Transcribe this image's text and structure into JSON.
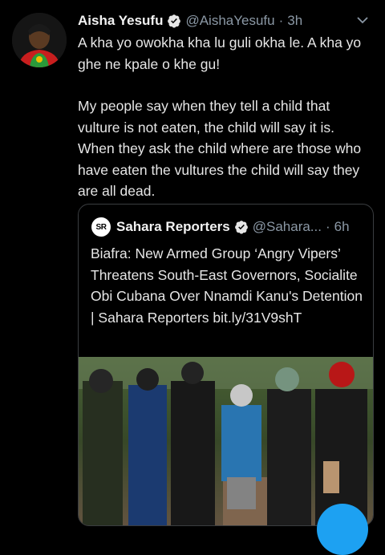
{
  "tweet": {
    "author_name": "Aisha Yesufu",
    "handle": "@AishaYesufu",
    "separator": "·",
    "time": "3h",
    "text_line1": "A kha yo owokha kha lu guli okha le. A kha yo ghe ne kpale o khe gu!",
    "text_line2": "My people say when they tell a child that vulture is not eaten, the child will say it is. When they ask the child where are those who have eaten the vultures the child will say they are all dead."
  },
  "quoted": {
    "logo_text": "SR",
    "author_name": "Sahara Reporters",
    "handle": "@Sahara...",
    "separator": "·",
    "time": "6h",
    "text": "Biafra: New Armed Group ‘Angry Vipers’ Threatens South-East Governors, Socialite Obi Cubana Over Nnamdi Kanu's Detention | Sahara Reporters bit.ly/31V9shT"
  },
  "icons": {
    "verified": "verified-badge-icon",
    "caret": "chevron-down-icon"
  },
  "colors": {
    "background": "#000000",
    "verified": "#1da1f2",
    "secondary_text": "#8b98a5",
    "fab": "#1da1f2"
  }
}
